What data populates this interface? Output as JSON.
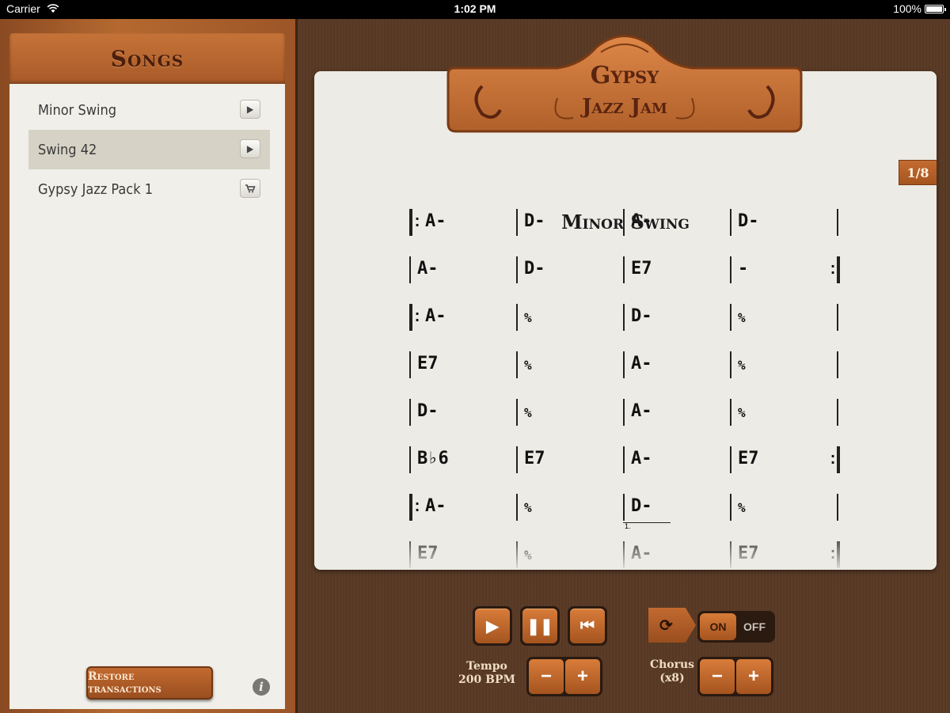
{
  "status_bar": {
    "carrier": "Carrier",
    "time": "1:02 PM",
    "battery": "100%",
    "battery_level": 1.0
  },
  "sidebar": {
    "title": "Songs",
    "songs": [
      {
        "name": "Minor Swing",
        "action_icon": "play-icon",
        "selected": false
      },
      {
        "name": "Swing 42",
        "action_icon": "play-icon",
        "selected": true
      },
      {
        "name": "Gypsy Jazz Pack 1",
        "action_icon": "cart-icon",
        "selected": false
      }
    ],
    "restore_label": "Restore transactions",
    "info_icon": "info-icon"
  },
  "logo": {
    "line1": "Gypsy",
    "line2": "Jazz Jam"
  },
  "sheet": {
    "song_title": "Minor Swing",
    "page": "1/8",
    "rows": [
      {
        "chords": [
          "A-",
          "D-",
          "A-",
          "D-"
        ],
        "start_repeat": true,
        "end_repeat": false
      },
      {
        "chords": [
          "A-",
          "D-",
          "E7",
          "-"
        ],
        "start_repeat": false,
        "end_repeat": true
      },
      {
        "chords": [
          "A-",
          "%",
          "D-",
          "%"
        ],
        "start_repeat": true,
        "end_repeat": false
      },
      {
        "chords": [
          "E7",
          "%",
          "A-",
          "%"
        ],
        "start_repeat": false,
        "end_repeat": false
      },
      {
        "chords": [
          "D-",
          "%",
          "A-",
          "%"
        ],
        "start_repeat": false,
        "end_repeat": false
      },
      {
        "chords": [
          "B♭6",
          "E7",
          "A-",
          "E7"
        ],
        "start_repeat": false,
        "end_repeat": true
      },
      {
        "chords": [
          "A-",
          "%",
          "D-",
          "%"
        ],
        "start_repeat": true,
        "end_repeat": false,
        "ending": "1."
      },
      {
        "chords": [
          "E7",
          "%",
          "A-",
          "E7"
        ],
        "start_repeat": false,
        "end_repeat": true
      }
    ]
  },
  "controls": {
    "play_icon": "play-icon",
    "pause_icon": "pause-icon",
    "rewind_icon": "skip-back-icon",
    "loop_icon": "loop-icon",
    "loop_on": "ON",
    "loop_off": "OFF",
    "tempo_label": "Tempo",
    "tempo_value": "200 BPM",
    "chorus_label": "Chorus",
    "chorus_value": "(x8)",
    "minus": "−",
    "plus": "+"
  },
  "colors": {
    "wood": "#b5652d",
    "background": "#5a3b26",
    "paper": "#ecebe5"
  }
}
